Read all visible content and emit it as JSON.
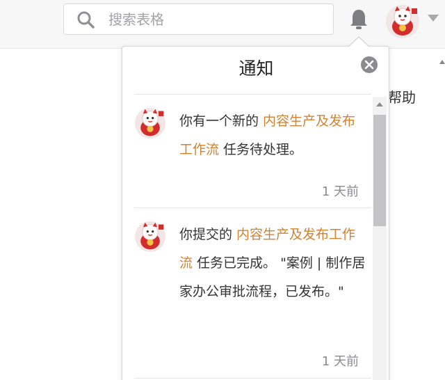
{
  "search": {
    "placeholder": "搜索表格"
  },
  "header": {
    "help_label": "帮助"
  },
  "notifications": {
    "title": "通知",
    "items": [
      {
        "prefix": "你有一个新的 ",
        "link": "内容生产及发布工作流",
        "suffix": " 任务待处理。",
        "time": "1 天前"
      },
      {
        "prefix": "你提交的 ",
        "link": "内容生产及发布工作流",
        "suffix": " 任务已完成。 \"案例 | 制作居家办公审批流程，已发布。\"",
        "time": "1 天前"
      }
    ]
  },
  "icons": {
    "search": "search-icon",
    "bell": "bell-icon",
    "avatar": "lucky-cat-avatar",
    "caret": "chevron-down-icon",
    "close": "close-circle-icon"
  },
  "colors": {
    "link": "#d2822f",
    "topbar_bg": "#f7f7f8",
    "close_bg": "#8a8a8f",
    "scroll_thumb": "#c3c3c6"
  }
}
